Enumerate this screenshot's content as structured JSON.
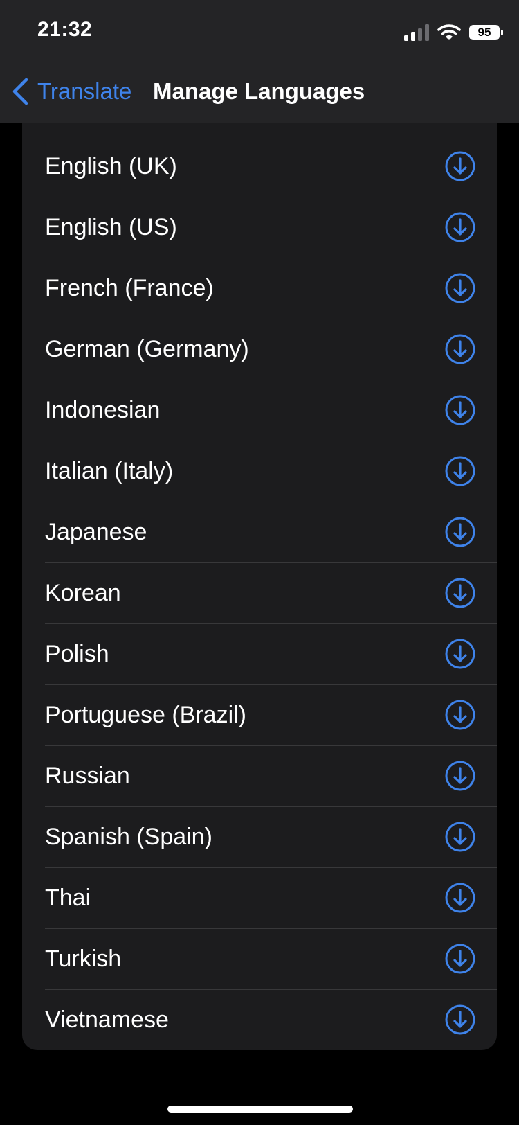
{
  "status_bar": {
    "time": "21:32",
    "battery": "95"
  },
  "nav": {
    "back_label": "Translate",
    "title": "Manage Languages"
  },
  "languages": [
    {
      "label": "English (UK)"
    },
    {
      "label": "English (US)"
    },
    {
      "label": "French (France)"
    },
    {
      "label": "German (Germany)"
    },
    {
      "label": "Indonesian"
    },
    {
      "label": "Italian (Italy)"
    },
    {
      "label": "Japanese"
    },
    {
      "label": "Korean"
    },
    {
      "label": "Polish"
    },
    {
      "label": "Portuguese (Brazil)"
    },
    {
      "label": "Russian"
    },
    {
      "label": "Spanish (Spain)"
    },
    {
      "label": "Thai"
    },
    {
      "label": "Turkish"
    },
    {
      "label": "Vietnamese"
    }
  ],
  "icons": {
    "download": "download-icon",
    "back": "chevron-left-icon"
  },
  "colors": {
    "accent": "#3f83ea",
    "background": "#000000",
    "card": "#1c1c1e"
  }
}
